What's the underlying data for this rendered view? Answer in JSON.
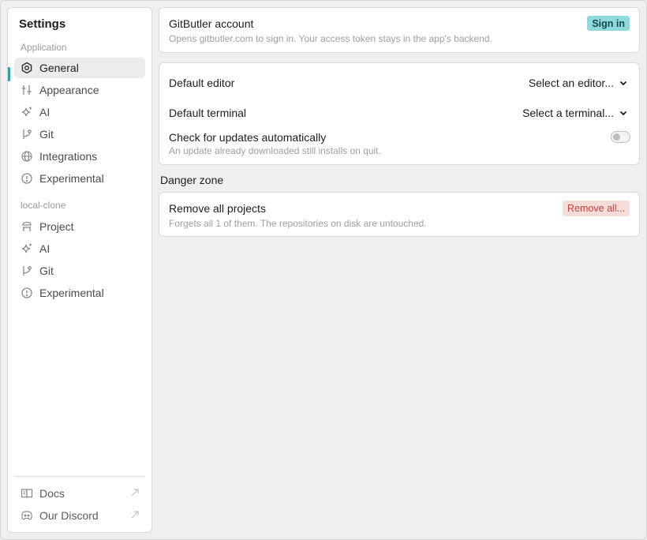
{
  "sidebar": {
    "title": "Settings",
    "app_section_label": "Application",
    "app_items": [
      {
        "label": "General",
        "icon": "gear-hexagon-icon",
        "active": true
      },
      {
        "label": "Appearance",
        "icon": "sliders-icon"
      },
      {
        "label": "AI",
        "icon": "sparkle-icon"
      },
      {
        "label": "Git",
        "icon": "git-branch-icon"
      },
      {
        "label": "Integrations",
        "icon": "globe-icon"
      },
      {
        "label": "Experimental",
        "icon": "alert-circle-icon"
      }
    ],
    "project_section_label": "local-clone",
    "project_items": [
      {
        "label": "Project",
        "icon": "project-icon"
      },
      {
        "label": "AI",
        "icon": "sparkle-icon"
      },
      {
        "label": "Git",
        "icon": "git-branch-icon"
      },
      {
        "label": "Experimental",
        "icon": "alert-circle-icon"
      }
    ],
    "footer": [
      {
        "label": "Docs",
        "icon": "book-icon"
      },
      {
        "label": "Our Discord",
        "icon": "discord-icon"
      }
    ]
  },
  "account": {
    "title": "GitButler account",
    "description": "Opens gitbutler.com to sign in. Your access token stays in the app's backend.",
    "sign_in_label": "Sign in"
  },
  "preferences": {
    "editor_label": "Default editor",
    "editor_value": "Select an editor...",
    "terminal_label": "Default terminal",
    "terminal_value": "Select a terminal...",
    "updates_label": "Check for updates automatically",
    "updates_description": "An update already downloaded still installs on quit.",
    "updates_enabled": false
  },
  "danger": {
    "heading": "Danger zone",
    "title": "Remove all projects",
    "description": "Forgets all 1 of them. The repositories on disk are untouched.",
    "button_label": "Remove all..."
  },
  "colors": {
    "accent": "#2e9ea8",
    "sign_in_bg": "#8fd9da",
    "danger_bg": "#f6ddda",
    "danger_text": "#c2453d"
  }
}
